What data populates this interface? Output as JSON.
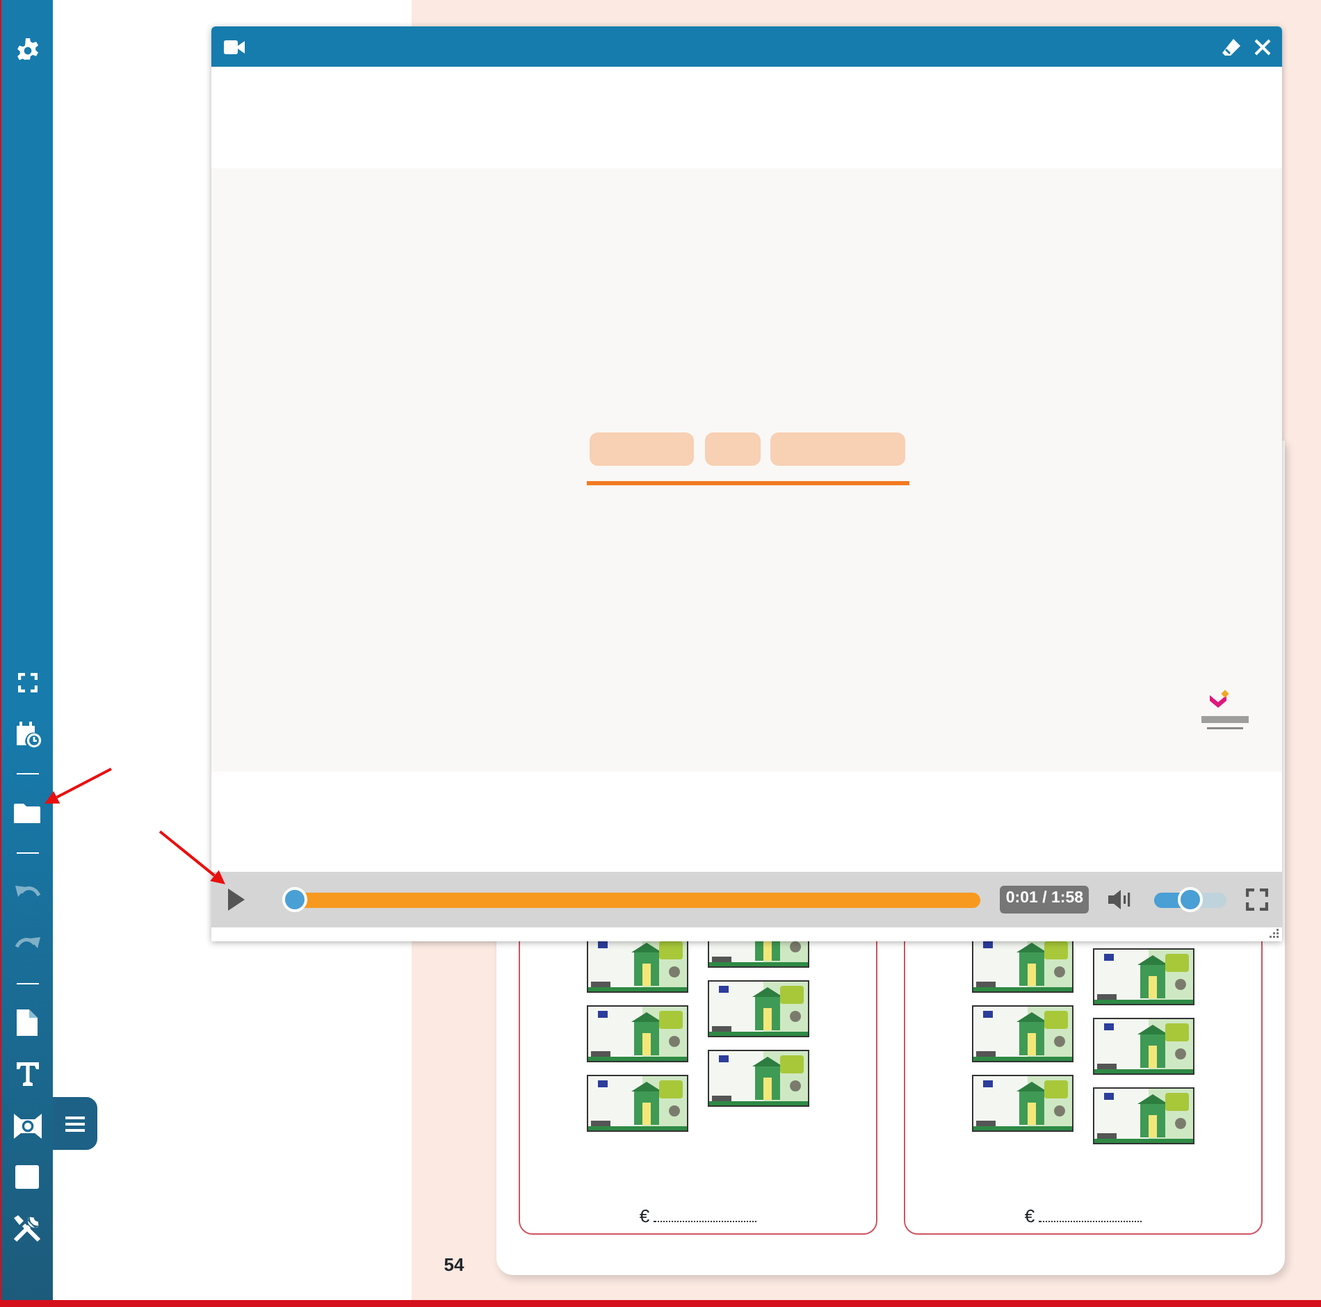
{
  "sidebar": {
    "tools": [
      {
        "kind": "settings",
        "disabled": false
      },
      {
        "kind": "spacer"
      },
      {
        "kind": "fullscreen",
        "disabled": false
      },
      {
        "kind": "calendar",
        "disabled": false
      },
      {
        "kind": "divider"
      },
      {
        "kind": "folder",
        "disabled": false
      },
      {
        "kind": "divider"
      },
      {
        "kind": "undo",
        "disabled": true
      },
      {
        "kind": "redo",
        "disabled": true
      },
      {
        "kind": "divider"
      },
      {
        "kind": "document",
        "disabled": false
      },
      {
        "kind": "text",
        "disabled": false
      },
      {
        "kind": "camera",
        "disabled": false
      },
      {
        "kind": "square",
        "disabled": false
      },
      {
        "kind": "tools",
        "disabled": false
      }
    ],
    "menu_button": {
      "expanded": false
    }
  },
  "video_window": {
    "player": {
      "playing": false,
      "progress": {
        "level": 0.015
      },
      "time": "0:01 / 1:58",
      "muted": false,
      "volume": {
        "level": 0.5
      }
    }
  },
  "workbook": {
    "page_number": "54",
    "boxes": [
      {
        "currency": "€"
      },
      {
        "currency": "€"
      }
    ]
  },
  "annotations": [
    {
      "kind": "arrow"
    },
    {
      "kind": "arrow"
    }
  ]
}
